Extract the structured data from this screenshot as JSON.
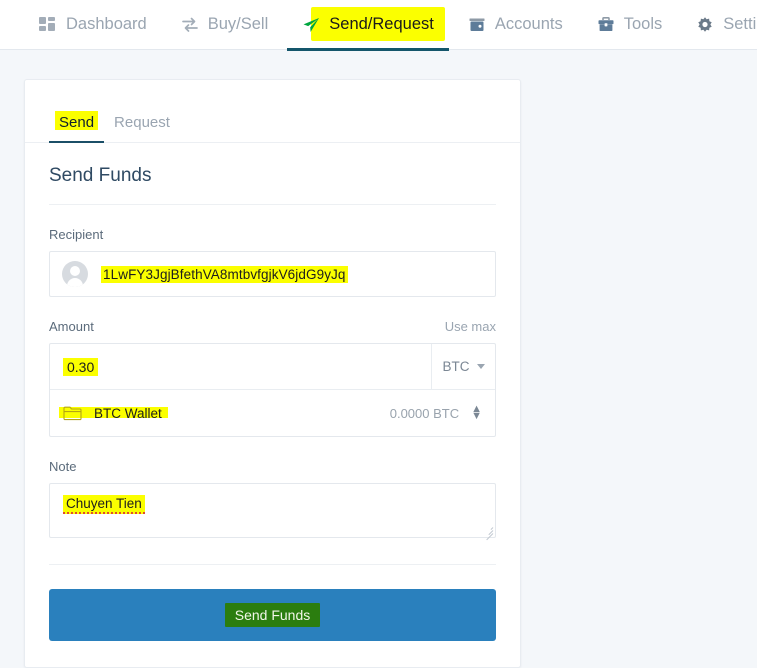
{
  "nav": {
    "items": [
      {
        "label": "Dashboard",
        "icon": "grid-icon",
        "active": false
      },
      {
        "label": "Buy/Sell",
        "icon": "exchange-arrows-icon",
        "active": false
      },
      {
        "label": "Send/Request",
        "icon": "paper-plane-icon",
        "active": true
      },
      {
        "label": "Accounts",
        "icon": "wallet-icon",
        "active": false
      },
      {
        "label": "Tools",
        "icon": "toolbox-icon",
        "active": false
      },
      {
        "label": "Settings",
        "icon": "gear-icon",
        "active": false
      }
    ]
  },
  "card": {
    "tabs": [
      {
        "label": "Send",
        "active": true
      },
      {
        "label": "Request",
        "active": false
      }
    ],
    "heading": "Send Funds",
    "recipient": {
      "label": "Recipient",
      "value": "1LwFY3JgjBfethVA8mtbvfgjkV6jdG9yJq",
      "avatar_icon": "user-avatar-icon"
    },
    "amount": {
      "label": "Amount",
      "use_max_label": "Use max",
      "value": "0.30",
      "currency": "BTC"
    },
    "wallet": {
      "icon": "folder-icon",
      "name": "BTC Wallet",
      "balance": "0.0000 BTC"
    },
    "note": {
      "label": "Note",
      "value": "Chuyen Tien"
    },
    "submit_label": "Send Funds"
  },
  "colors": {
    "highlight": "#fbff00",
    "button_blue": "#2a80bd",
    "green_highlight": "#2b7d0f",
    "active_underline": "#14566b",
    "page_background": "#f4f7fa"
  }
}
